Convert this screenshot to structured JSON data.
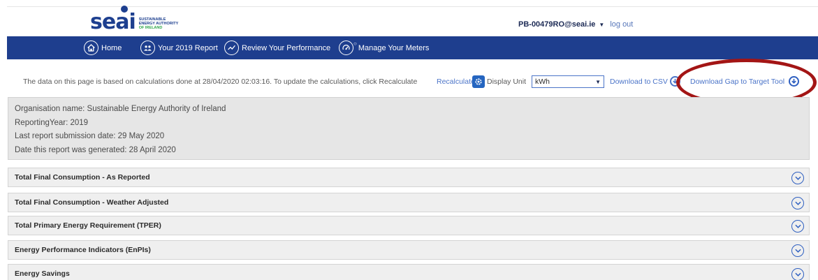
{
  "header": {
    "logo_text": "seai",
    "logo_sub_1": "SUSTAINABLE",
    "logo_sub_2": "ENERGY AUTHORITY",
    "logo_sub_3": "OF IRELAND",
    "user_email": "PB-00479RO@seai.ie",
    "logout_label": "log out"
  },
  "nav": {
    "items": [
      {
        "label": "Home",
        "icon": "home-icon"
      },
      {
        "label": "Your 2019 Report",
        "icon": "report-icon"
      },
      {
        "label": "Review Your Performance",
        "icon": "chart-icon"
      },
      {
        "label": "Manage Your Meters",
        "icon": "meter-icon"
      }
    ]
  },
  "infobar": {
    "text": "The data on this page is based on calculations done at 28/04/2020 02:03:16. To update the calculations, click Recalculate",
    "recalculate_label": "Recalculate",
    "display_unit_label": "Display Unit",
    "unit_value": "kWh",
    "download_csv_label": "Download to CSV",
    "download_gap_label": "Download Gap to Target Tool"
  },
  "org": {
    "name_line": "Organisation name: Sustainable Energy Authority of Ireland",
    "year_line": "ReportingYear: 2019",
    "submission_line": "Last report submission date: 29 May 2020",
    "generated_line": "Date this report was generated: 28 April 2020"
  },
  "sections": [
    {
      "title": "Total Final Consumption - As Reported"
    },
    {
      "title": "Total Final Consumption - Weather Adjusted"
    },
    {
      "title": "Total Primary Energy Requirement (TPER)"
    },
    {
      "title": "Energy Performance Indicators (EnPIs)"
    },
    {
      "title": "Energy Savings"
    }
  ],
  "colors": {
    "brand_blue": "#1e3e8e",
    "link_blue": "#4b74c8",
    "highlight_red": "#a31515",
    "logo_green": "#2fa64a"
  }
}
